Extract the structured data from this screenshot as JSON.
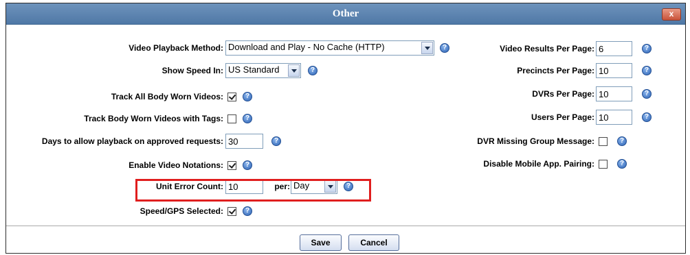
{
  "dialog": {
    "title": "Other",
    "close_label": "x"
  },
  "left": {
    "video_playback_method": {
      "label": "Video Playback Method:",
      "value": "Download and Play - No Cache (HTTP)"
    },
    "show_speed_in": {
      "label": "Show Speed In:",
      "value": "US Standard"
    },
    "track_all_body_worn": {
      "label": "Track All Body Worn Videos:",
      "checked": true
    },
    "track_body_worn_tags": {
      "label": "Track Body Worn Videos with Tags:",
      "checked": false
    },
    "days_allow_playback": {
      "label": "Days to allow playback on approved requests:",
      "value": "30"
    },
    "enable_video_notations": {
      "label": "Enable Video Notations:",
      "checked": true
    },
    "unit_error_count": {
      "label": "Unit Error Count:",
      "value": "10",
      "per_label": "per:",
      "per_value": "Day"
    },
    "speed_gps_selected": {
      "label": "Speed/GPS Selected:",
      "checked": true
    }
  },
  "right": {
    "video_results_per_page": {
      "label": "Video Results Per Page:",
      "value": "6"
    },
    "precincts_per_page": {
      "label": "Precincts Per Page:",
      "value": "10"
    },
    "dvrs_per_page": {
      "label": "DVRs Per Page:",
      "value": "10"
    },
    "users_per_page": {
      "label": "Users Per Page:",
      "value": "10"
    },
    "dvr_missing_group_message": {
      "label": "DVR Missing Group Message:",
      "checked": false
    },
    "disable_mobile_app_pairing": {
      "label": "Disable Mobile App. Pairing:",
      "checked": false
    }
  },
  "buttons": {
    "save": "Save",
    "cancel": "Cancel"
  },
  "help_glyph": "?",
  "colors": {
    "titlebar": "#5a82ae",
    "highlight": "#e01e1e",
    "help_icon": "#2c63b5"
  }
}
